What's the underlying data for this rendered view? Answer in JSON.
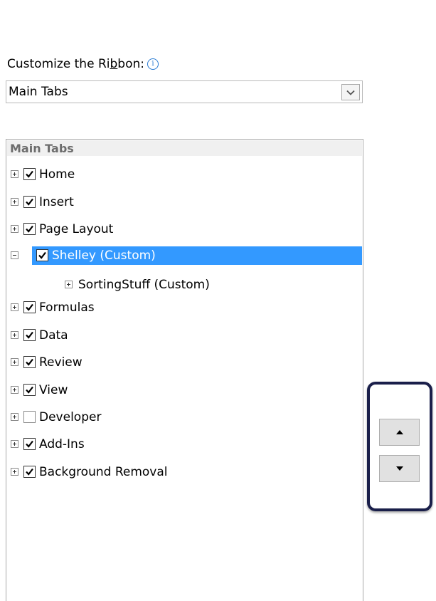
{
  "heading": {
    "text_before": "Customize the Ri",
    "accel": "b",
    "text_after": "bon:",
    "info_icon": "i"
  },
  "dropdown": {
    "value": "Main Tabs"
  },
  "tree": {
    "group_header": "Main Tabs",
    "items": [
      {
        "label": "Home",
        "checked": true
      },
      {
        "label": "Insert",
        "checked": true
      },
      {
        "label": "Page Layout",
        "checked": true
      },
      {
        "label": "Shelley (Custom)",
        "checked": true,
        "selected": true,
        "expanded": true
      },
      {
        "label": "SortingStuff (Custom)",
        "child": true
      },
      {
        "label": "Formulas",
        "checked": true
      },
      {
        "label": "Data",
        "checked": true
      },
      {
        "label": "Review",
        "checked": true
      },
      {
        "label": "View",
        "checked": true
      },
      {
        "label": "Developer",
        "checked": false
      },
      {
        "label": "Add-Ins",
        "checked": true
      },
      {
        "label": "Background Removal",
        "checked": true
      }
    ]
  },
  "move_buttons": {
    "up_icon": "triangle-up-icon",
    "down_icon": "triangle-down-icon"
  },
  "colors": {
    "selection": "#3399ff",
    "annotation_frame": "#1a1f4a",
    "info_icon": "#2a7bd3"
  }
}
